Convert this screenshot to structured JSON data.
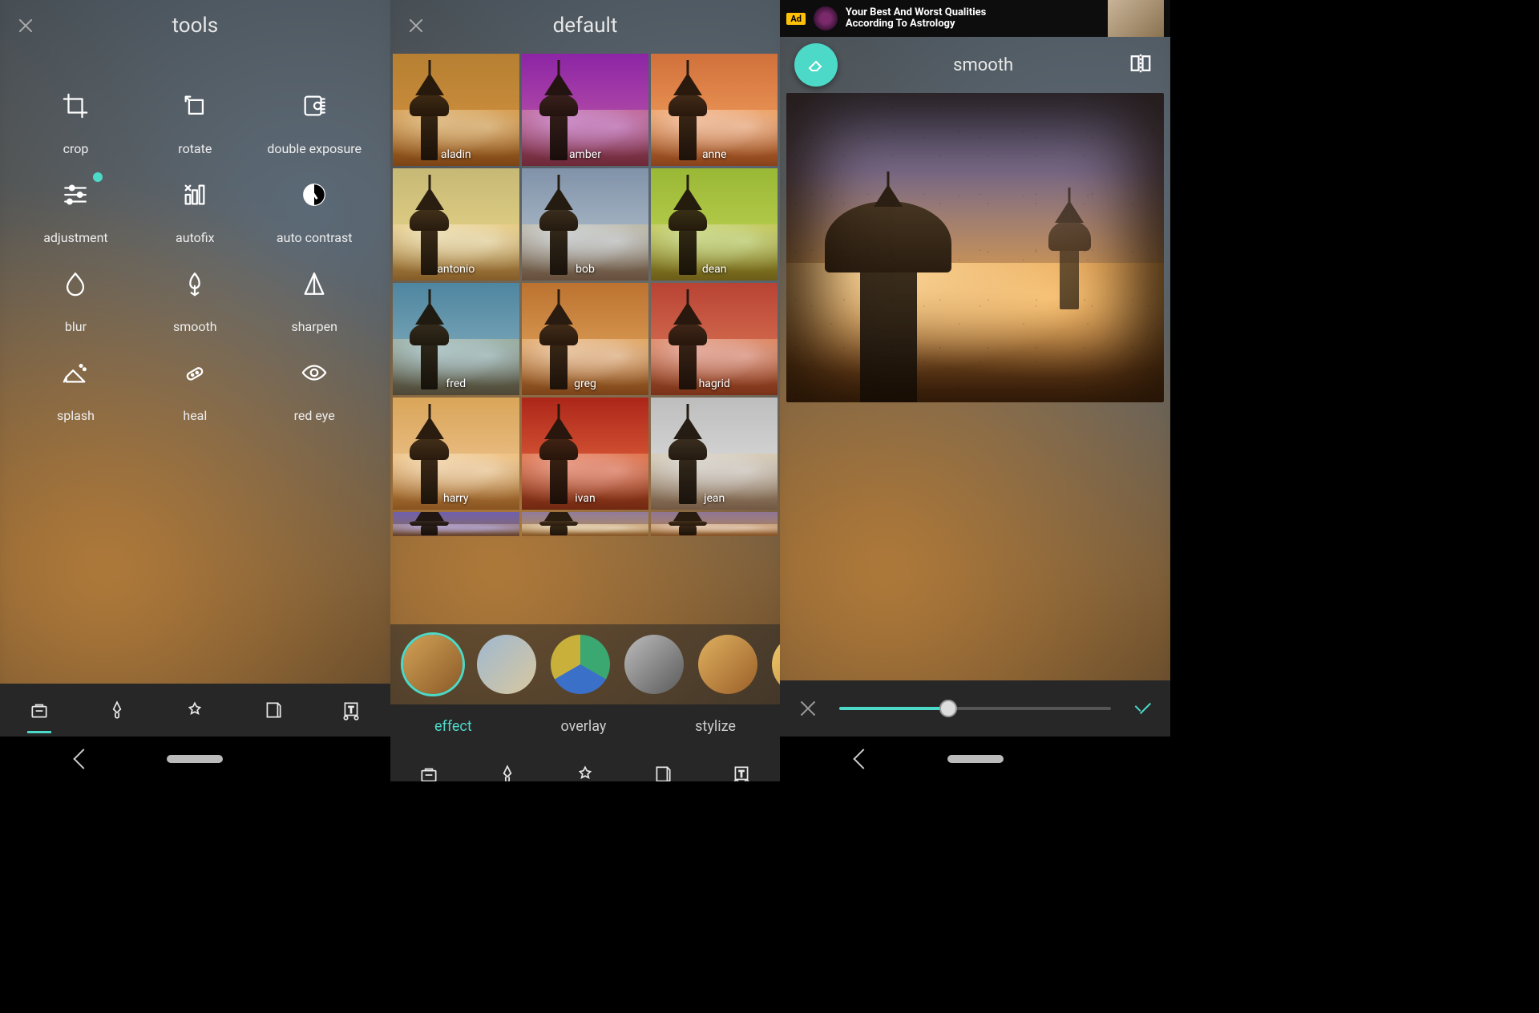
{
  "colors": {
    "accent": "#4dd9c8"
  },
  "panel1": {
    "title": "tools",
    "tools": [
      {
        "id": "crop",
        "label": "crop"
      },
      {
        "id": "rotate",
        "label": "rotate"
      },
      {
        "id": "double-exposure",
        "label": "double exposure"
      },
      {
        "id": "adjustment",
        "label": "adjustment",
        "badge": true
      },
      {
        "id": "autofix",
        "label": "autofix"
      },
      {
        "id": "auto-contrast",
        "label": "auto contrast"
      },
      {
        "id": "blur",
        "label": "blur"
      },
      {
        "id": "smooth",
        "label": "smooth"
      },
      {
        "id": "sharpen",
        "label": "sharpen"
      },
      {
        "id": "splash",
        "label": "splash"
      },
      {
        "id": "heal",
        "label": "heal"
      },
      {
        "id": "red-eye",
        "label": "red eye"
      }
    ],
    "toolbar": {
      "active_index": 0,
      "items": [
        "toolbox",
        "brush",
        "effects",
        "layers",
        "text"
      ]
    }
  },
  "panel2": {
    "title": "default",
    "filters": [
      {
        "name": "aladin",
        "tint": "rgba(200,140,40,.45)",
        "sky": "linear-gradient(180deg,#caa050,#e0b060 60%,#b57a2a)"
      },
      {
        "name": "amber",
        "tint": "rgba(160,40,180,.45)",
        "sky": "linear-gradient(180deg,#a93bbf,#d070c0 55%,#9a3a90)"
      },
      {
        "name": "anne",
        "tint": "rgba(230,120,60,.35)",
        "sky": "linear-gradient(180deg,#d88a50,#f0b070 55%,#c06a30)"
      },
      {
        "name": "antonio",
        "tint": "rgba(220,200,120,.35)",
        "sky": "linear-gradient(180deg,#d0c890,#e8dca0 55%,#b8a860)"
      },
      {
        "name": "bob",
        "tint": "rgba(140,160,180,.35)",
        "sky": "linear-gradient(180deg,#98a8bc,#c0ccd8 55%,#788898)"
      },
      {
        "name": "dean",
        "tint": "rgba(160,200,60,.45)",
        "sky": "linear-gradient(180deg,#b8cc50,#d8e070 55%,#98b030)"
      },
      {
        "name": "fred",
        "tint": "rgba(90,150,170,.4)",
        "sky": "linear-gradient(180deg,#6aa0b8,#9ac0d0 55%,#4a7888)"
      },
      {
        "name": "greg",
        "tint": "rgba(210,120,40,.3)",
        "sky": "linear-gradient(180deg,#c88840,#e0b068 55%,#a06828)"
      },
      {
        "name": "hagrid",
        "tint": "rgba(200,70,50,.35)",
        "sky": "linear-gradient(180deg,#c85a48,#e08868 55%,#9a3a28)"
      },
      {
        "name": "harry",
        "tint": "rgba(230,170,80,.3)",
        "sky": "linear-gradient(180deg,#e0b870,#f0d0a0 55%,#c09040)"
      },
      {
        "name": "ivan",
        "tint": "rgba(220,70,40,.45)",
        "sky": "linear-gradient(180deg,#b83828,#e07850 55%,#7a2015)"
      },
      {
        "name": "jean",
        "tint": "rgba(100,100,100,.2)",
        "sky": "linear-gradient(180deg,#d8d8d8,#f0f0f0 55%,#a8a8a8)",
        "mono": true
      }
    ],
    "partial_row_tints": [
      "rgba(100,80,200,.45)",
      "rgba(200,150,60,.25)",
      "rgba(200,130,70,.3)"
    ],
    "styles": [
      {
        "id": "default",
        "selected": true,
        "bg": "linear-gradient(135deg,#d2a256,#8a5a28)"
      },
      {
        "id": "soft",
        "bg": "linear-gradient(135deg,#9fb8d0,#d8c8a0)"
      },
      {
        "id": "split",
        "bg": "conic-gradient(#3aa870 0 120deg,#3a70c8 120deg 240deg,#c8b03a 240deg)"
      },
      {
        "id": "mono",
        "bg": "linear-gradient(135deg,#bcbcbc,#5a5a5a)"
      },
      {
        "id": "warm",
        "bg": "linear-gradient(135deg,#e0b060,#9a6028)"
      },
      {
        "id": "gold",
        "bg": "linear-gradient(135deg,#f0c870,#b88830)"
      },
      {
        "id": "psych",
        "bg": "conic-gradient(#ff3a8a,#3a8aff,#3affa0,#ffea3a,#ff3a8a)"
      }
    ],
    "tabs": [
      {
        "id": "effect",
        "label": "effect",
        "active": true
      },
      {
        "id": "overlay",
        "label": "overlay"
      },
      {
        "id": "stylize",
        "label": "stylize"
      }
    ],
    "toolbar": {
      "active_index": 2,
      "items": [
        "toolbox",
        "brush",
        "effects",
        "layers",
        "text"
      ]
    }
  },
  "panel3": {
    "ad": {
      "badge": "Ad",
      "line1": "Your Best And Worst Qualities",
      "line2": "According To Astrology"
    },
    "title": "smooth",
    "slider": {
      "value": 40,
      "min": 0,
      "max": 100
    }
  }
}
